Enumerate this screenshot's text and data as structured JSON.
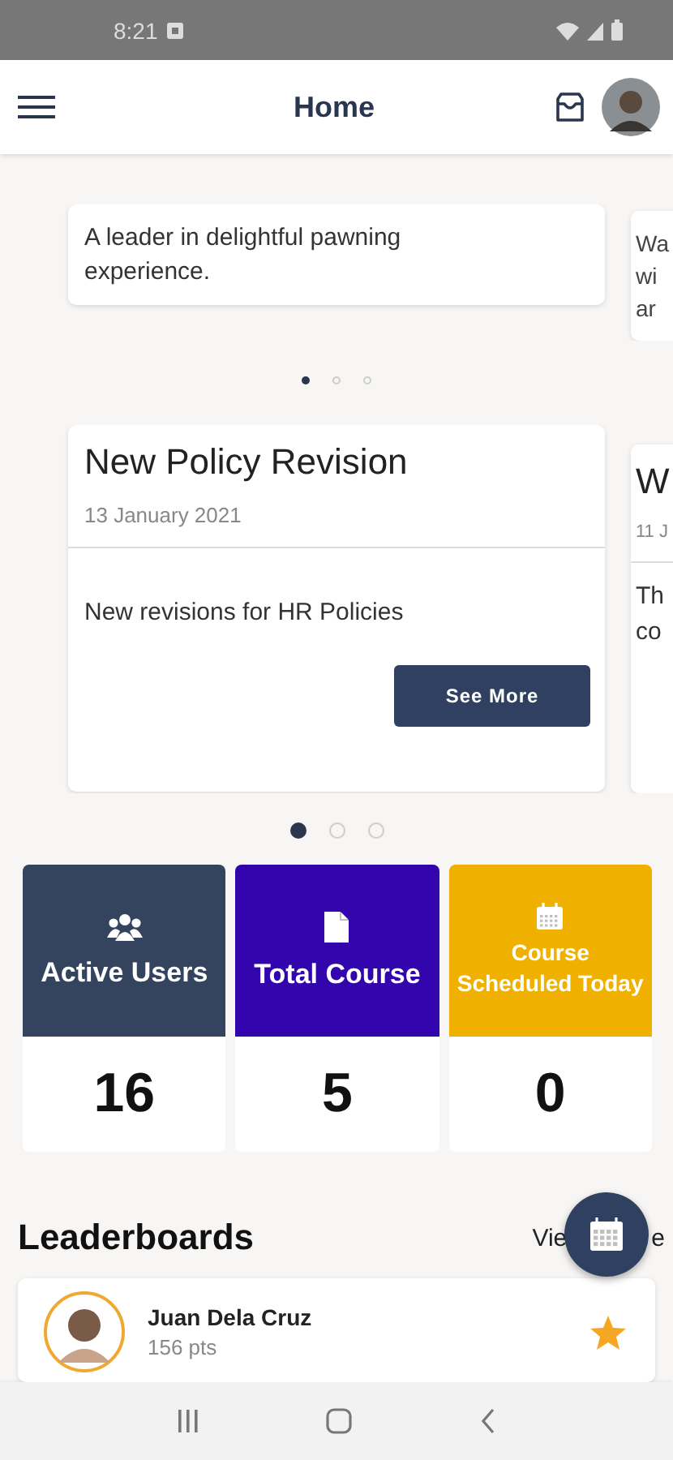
{
  "status_bar": {
    "time": "8:21"
  },
  "header": {
    "title": "Home"
  },
  "quote_carousel": {
    "cards": [
      {
        "text": "A leader in delightful pawning experience."
      },
      {
        "lines": [
          "Wa",
          "wi",
          "ar"
        ]
      }
    ],
    "dots": [
      {
        "selected": true
      },
      {
        "selected": false
      },
      {
        "selected": false
      }
    ]
  },
  "news_carousel": {
    "cards": [
      {
        "title": "New Policy Revision",
        "date": "13 January 2021",
        "body": "New revisions for HR Policies",
        "button": "See More"
      },
      {
        "title": "W",
        "date": "11 J",
        "body_lines": [
          "Th",
          "co"
        ]
      }
    ],
    "dots": [
      {
        "selected": true
      },
      {
        "selected": false
      },
      {
        "selected": false
      }
    ]
  },
  "stats": [
    {
      "kind": "users",
      "label": "Active Users",
      "value": "16",
      "color": "#34435e"
    },
    {
      "kind": "file",
      "label": "Total Course",
      "value": "5",
      "color": "#3305ad"
    },
    {
      "kind": "calendar",
      "label": "Course Scheduled Today",
      "value": "0",
      "color": "#f0b000"
    }
  ],
  "leaderboards": {
    "title": "Leaderboards",
    "link_parts": [
      "Vie",
      "e"
    ],
    "entries": [
      {
        "name": "Juan Dela Cruz",
        "points": "156 pts"
      }
    ]
  }
}
